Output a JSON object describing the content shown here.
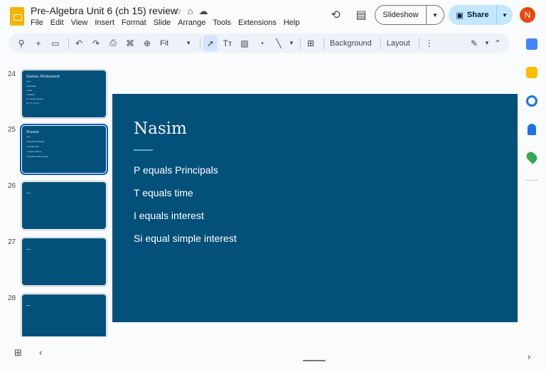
{
  "header": {
    "title": "Pre-Algebra Unit 6 (ch 15) review",
    "menu": [
      "File",
      "Edit",
      "View",
      "Insert",
      "Format",
      "Slide",
      "Arrange",
      "Tools",
      "Extensions",
      "Help"
    ],
    "slideshow_label": "Slideshow",
    "share_label": "Share",
    "avatar_initial": "N"
  },
  "toolbar": {
    "zoom_label": "Fit",
    "background_label": "Background",
    "layout_label": "Layout"
  },
  "filmstrip": {
    "slides": [
      {
        "number": "24",
        "title": "Samia Mohamed",
        "items": [
          "P principle",
          "T time",
          "I interest",
          "S I simple interest",
          "SI = P x R x T"
        ]
      },
      {
        "number": "25",
        "title": "Nasim",
        "items": [
          "P equals Principals",
          "T equals time",
          "I equals interest",
          "Si equal simple interest"
        ]
      },
      {
        "number": "26",
        "title": "",
        "items": []
      },
      {
        "number": "27",
        "title": "",
        "items": []
      },
      {
        "number": "28",
        "title": "",
        "items": []
      }
    ]
  },
  "slide": {
    "title": "Nasim",
    "body": [
      "P equals Principals",
      "T equals time",
      "I equals interest",
      "Si equal simple interest"
    ]
  },
  "colors": {
    "slide_bg": "#03507a",
    "accent": "#4fb0e5",
    "share_bg": "#c2e7ff",
    "avatar_bg": "#e8470f",
    "selected_outline": "#0b57d0"
  }
}
